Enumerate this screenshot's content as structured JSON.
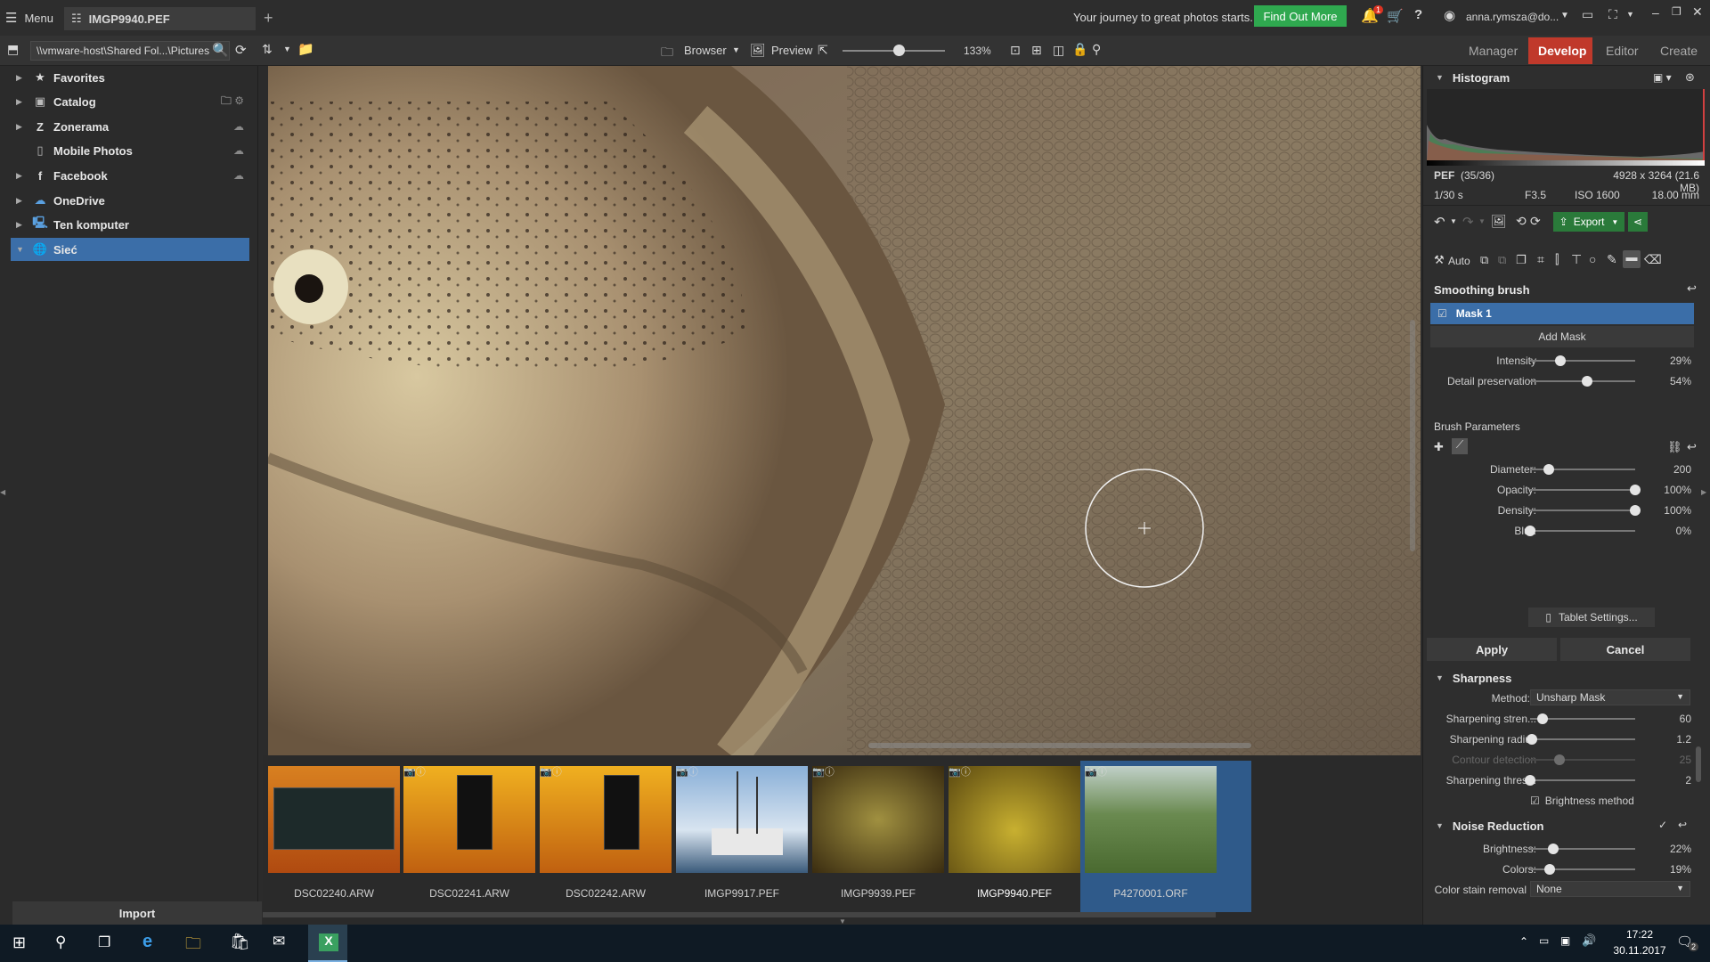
{
  "titlebar": {
    "menu_label": "Menu",
    "tab_title": "IMGP9940.PEF",
    "add_tab": "+",
    "promo_text": "Your journey to great photos starts...",
    "promo_button": "Find Out More",
    "notification_count": "1",
    "user": "anna.rymsza@do...",
    "accent": "#2fa84f"
  },
  "toolbar": {
    "path": "\\\\vmware-host\\Shared Fol...\\Pictures",
    "browser_label": "Browser",
    "preview_label": "Preview",
    "zoom": "133%",
    "zoom_level": 0.55,
    "modes": [
      "Manager",
      "Develop",
      "Editor",
      "Create"
    ],
    "active_mode": "Develop",
    "develop_color": "#c0392b"
  },
  "tree": [
    {
      "label": "Favorites",
      "icon": "star-icon"
    },
    {
      "label": "Catalog",
      "icon": "catalog-icon"
    },
    {
      "label": "Zonerama",
      "icon": "zonerama-icon"
    },
    {
      "label": "Mobile Photos",
      "icon": "phone-icon"
    },
    {
      "label": "Facebook",
      "icon": "facebook-icon"
    },
    {
      "label": "OneDrive",
      "icon": "onedrive-icon"
    },
    {
      "label": "Ten komputer",
      "icon": "computer-icon"
    },
    {
      "label": "Sieć",
      "icon": "network-icon"
    }
  ],
  "import_label": "Import",
  "filmstrip": [
    {
      "name": "DSC02240.ARW"
    },
    {
      "name": "DSC02241.ARW"
    },
    {
      "name": "DSC02242.ARW"
    },
    {
      "name": "IMGP9917.PEF"
    },
    {
      "name": "IMGP9939.PEF"
    },
    {
      "name": "IMGP9940.PEF"
    },
    {
      "name": "P4270001.ORF"
    }
  ],
  "histogram": {
    "title": "Histogram",
    "format": "PEF",
    "index": "(35/36)",
    "dimensions": "4928 x 3264 (21.6 MB)",
    "shutter": "1/30 s",
    "aperture": "F3.5",
    "iso": "ISO 1600",
    "focal": "18.00 mm"
  },
  "actions": {
    "export_label": "Export",
    "auto_label": "Auto"
  },
  "smoothing": {
    "title": "Smoothing brush",
    "mask_label": "Mask 1",
    "add_mask": "Add Mask",
    "sliders": [
      {
        "label": "Intensity",
        "value": "29%",
        "level": 0.29
      },
      {
        "label": "Detail preservation",
        "value": "54%",
        "level": 0.54
      }
    ],
    "brush_params": "Brush Parameters",
    "brush_sliders": [
      {
        "label": "Diameter:",
        "value": "200",
        "level": 0.18
      },
      {
        "label": "Opacity:",
        "value": "100%",
        "level": 1.0
      },
      {
        "label": "Density:",
        "value": "100%",
        "level": 1.0
      },
      {
        "label": "Blur:",
        "value": "0%",
        "level": 0.0
      }
    ],
    "tablet_settings": "Tablet Settings...",
    "apply": "Apply",
    "cancel": "Cancel"
  },
  "sharpness": {
    "title": "Sharpness",
    "method_label": "Method:",
    "method_value": "Unsharp Mask",
    "sliders": [
      {
        "label": "Sharpening stren...",
        "value": "60",
        "level": 0.12
      },
      {
        "label": "Sharpening radius",
        "value": "1.2",
        "level": 0.02
      },
      {
        "label": "Contour detection",
        "value": "25",
        "level": 0.28
      },
      {
        "label": "Sharpening thres...",
        "value": "2",
        "level": 0.0
      }
    ],
    "brightness_method": "Brightness method"
  },
  "noise": {
    "title": "Noise Reduction",
    "sliders": [
      {
        "label": "Brightness:",
        "value": "22%",
        "level": 0.22
      },
      {
        "label": "Colors:",
        "value": "19%",
        "level": 0.19
      }
    ],
    "stain_label": "Color stain removal",
    "stain_value": "None"
  },
  "taskbar": {
    "time": "17:22",
    "date": "30.11.2017",
    "notif": "2"
  }
}
